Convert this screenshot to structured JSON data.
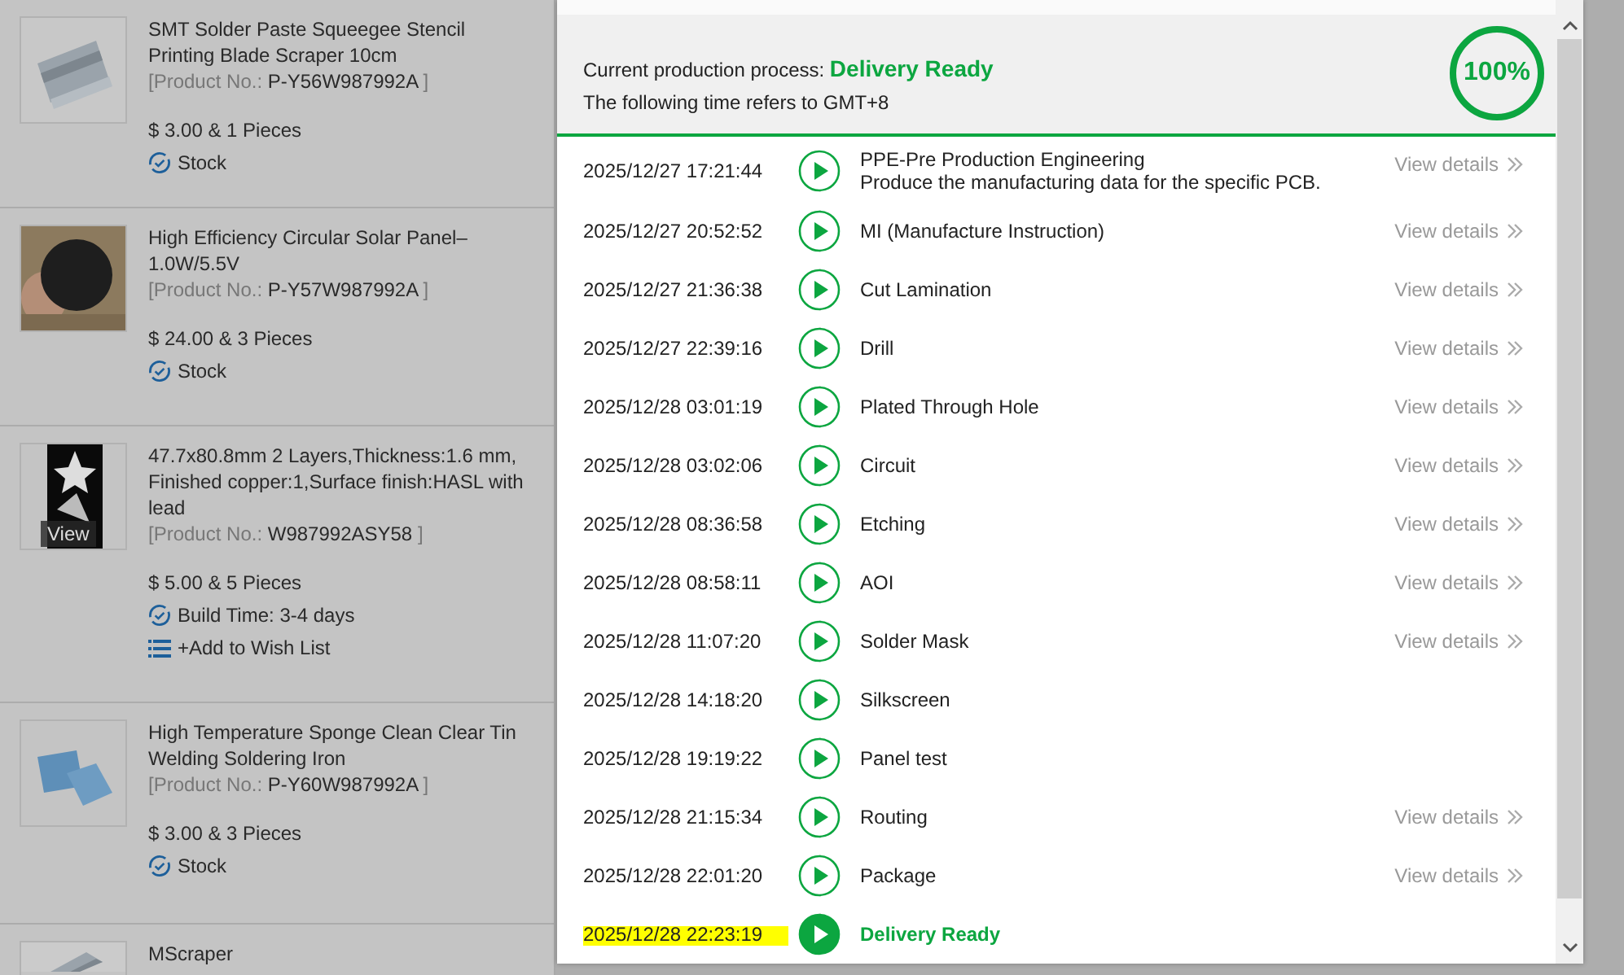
{
  "products": [
    {
      "title": "SMT Solder Paste Squeegee Stencil Printing Blade Scraper 10cm",
      "product_no_label": "[Product No.:",
      "product_no": "P-Y56W987992A",
      "product_no_end": "]",
      "price": "$ 3.00 & 1 Pieces",
      "status": "Stock",
      "kind": "picture"
    },
    {
      "title": "High Efficiency Circular Solar Panel–1.0W/5.5V",
      "product_no_label": "[Product No.:",
      "product_no": "P-Y57W987992A",
      "product_no_end": "]",
      "price": "$ 24.00 & 3 Pieces",
      "status": "Stock",
      "kind": "picture"
    },
    {
      "title": "47.7x80.8mm 2 Layers,Thickness:1.6 mm, Finished copper:1,Surface finish:HASL with lead",
      "product_no_label": "[Product No.:",
      "product_no": "W987992ASY58",
      "product_no_end": "]",
      "price": "$ 5.00 & 5 Pieces",
      "status": "Build Time: 3-4 days",
      "wish_list": "+Add to Wish List",
      "kind": "picture",
      "view_label": "View"
    },
    {
      "title": "High Temperature Sponge Clean Clear Tin Welding Soldering Iron",
      "product_no_label": "[Product No.:",
      "product_no": "P-Y60W987992A",
      "product_no_end": "]",
      "price": "$ 3.00 & 3 Pieces",
      "status": "Stock",
      "kind": "picture"
    },
    {
      "title": "MScraper",
      "kind": "picture"
    }
  ],
  "modal": {
    "process_label": "Current production process:",
    "process_value": "Delivery Ready",
    "timezone_note": "The following time refers to GMT+8",
    "progress": {
      "label": "100%",
      "level": 1
    },
    "steps": [
      {
        "time": "2025/12/27 17:21:44",
        "title": "PPE-Pre Production Engineering",
        "description": "Produce the manufacturing data for the specific PCB.",
        "details": "View details",
        "current": false,
        "highlighted": false
      },
      {
        "time": "2025/12/27 20:52:52",
        "title": "MI (Manufacture Instruction)",
        "details": "View details",
        "current": false,
        "highlighted": false
      },
      {
        "time": "2025/12/27 21:36:38",
        "title": "Cut Lamination",
        "details": "View details",
        "current": false,
        "highlighted": false
      },
      {
        "time": "2025/12/27 22:39:16",
        "title": "Drill",
        "details": "View details",
        "current": false,
        "highlighted": false
      },
      {
        "time": "2025/12/28 03:01:19",
        "title": "Plated Through Hole",
        "details": "View details",
        "current": false,
        "highlighted": false
      },
      {
        "time": "2025/12/28 03:02:06",
        "title": "Circuit",
        "details": "View details",
        "current": false,
        "highlighted": false
      },
      {
        "time": "2025/12/28 08:36:58",
        "title": "Etching",
        "details": "View details",
        "current": false,
        "highlighted": false
      },
      {
        "time": "2025/12/28 08:58:11",
        "title": "AOI",
        "details": "View details",
        "current": false,
        "highlighted": false
      },
      {
        "time": "2025/12/28 11:07:20",
        "title": "Solder Mask",
        "details": "View details",
        "current": false,
        "highlighted": false
      },
      {
        "time": "2025/12/28 14:18:20",
        "title": "Silkscreen",
        "current": false,
        "highlighted": false
      },
      {
        "time": "2025/12/28 19:19:22",
        "title": "Panel test",
        "current": false,
        "highlighted": false
      },
      {
        "time": "2025/12/28 21:15:34",
        "title": "Routing",
        "details": "View details",
        "current": false,
        "highlighted": false
      },
      {
        "time": "2025/12/28 22:01:20",
        "title": "Package",
        "details": "View details",
        "current": false,
        "highlighted": false
      },
      {
        "time": "2025/12/28 22:23:19",
        "title": "Delivery Ready",
        "current": true,
        "highlighted": true
      }
    ]
  }
}
